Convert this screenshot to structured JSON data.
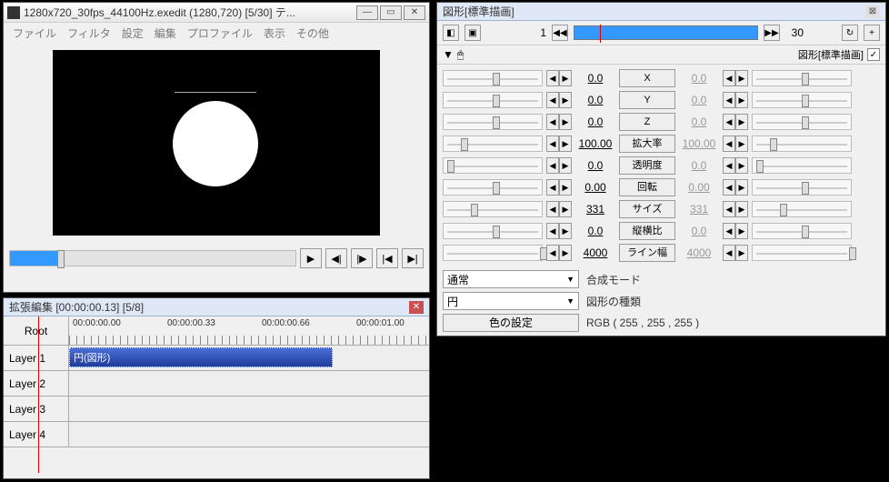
{
  "preview": {
    "title": "1280x720_30fps_44100Hz.exedit (1280,720) [5/30] テ...",
    "menu": [
      "ファイル",
      "フィルタ",
      "設定",
      "編集",
      "プロファイル",
      "表示",
      "その他"
    ]
  },
  "timeline": {
    "title": "拡張編集 [00:00:00.13] [5/8]",
    "root": "Root",
    "ticks": [
      "00:00:00.00",
      "00:00:00.33",
      "00:00:00.66",
      "00:00:01.00"
    ],
    "layers": [
      "Layer 1",
      "Layer 2",
      "Layer 3",
      "Layer 4"
    ],
    "clip": "円(図形)"
  },
  "prop": {
    "title": "図形[標準描画]",
    "frame_start": "1",
    "frame_end": "30",
    "section_label": "図形[標準描画]",
    "params": [
      {
        "name": "X",
        "v1": "0.0",
        "v2": "0.0",
        "pos1": 50,
        "pos2": 50
      },
      {
        "name": "Y",
        "v1": "0.0",
        "v2": "0.0",
        "pos1": 50,
        "pos2": 50
      },
      {
        "name": "Z",
        "v1": "0.0",
        "v2": "0.0",
        "pos1": 50,
        "pos2": 50
      },
      {
        "name": "拡大率",
        "v1": "100.00",
        "v2": "100.00",
        "pos1": 18,
        "pos2": 18
      },
      {
        "name": "透明度",
        "v1": "0.0",
        "v2": "0.0",
        "pos1": 4,
        "pos2": 4
      },
      {
        "name": "回転",
        "v1": "0.00",
        "v2": "0.00",
        "pos1": 50,
        "pos2": 50
      },
      {
        "name": "サイズ",
        "v1": "331",
        "v2": "331",
        "pos1": 28,
        "pos2": 28
      },
      {
        "name": "縦横比",
        "v1": "0.0",
        "v2": "0.0",
        "pos1": 50,
        "pos2": 50
      },
      {
        "name": "ライン幅",
        "v1": "4000",
        "v2": "4000",
        "pos1": 98,
        "pos2": 98
      }
    ],
    "blend_label": "合成モード",
    "blend_value": "通常",
    "shape_label": "図形の種類",
    "shape_value": "円",
    "color_btn": "色の設定",
    "color_value": "RGB ( 255 , 255 , 255 )"
  }
}
